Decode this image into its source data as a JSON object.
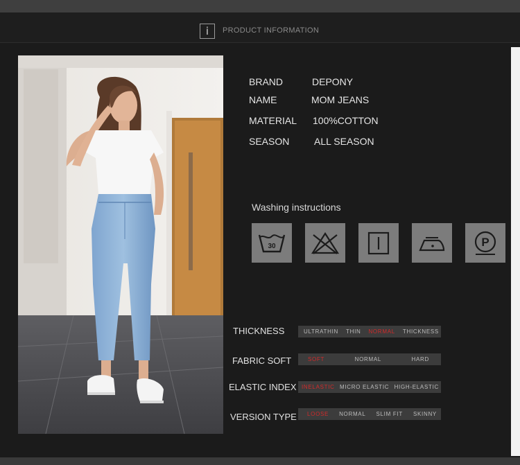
{
  "header": {
    "info_icon_glyph": "i",
    "title": "PRODUCT INFORMATION"
  },
  "product": {
    "photo_icon": "model-photo",
    "specs": [
      {
        "label": "BRAND",
        "value": "DEPONY"
      },
      {
        "label": "NAME",
        "value": "MOM JEANS"
      },
      {
        "label": "MATERIAL",
        "value": "100%COTTON"
      },
      {
        "label": "SEASON",
        "value": "ALL SEASON"
      }
    ]
  },
  "washing": {
    "title": "Washing instructions",
    "icons": [
      {
        "name": "wash-30-icon",
        "text": "30"
      },
      {
        "name": "do-not-bleach-icon"
      },
      {
        "name": "tumble-dry-icon"
      },
      {
        "name": "iron-icon"
      },
      {
        "name": "dry-clean-p-icon",
        "text": "P"
      }
    ]
  },
  "ratings": [
    {
      "label": "THICKNESS",
      "options": [
        "ULTRATHIN",
        "THIN",
        "NORMAL",
        "THICKNESS"
      ],
      "selected": 2
    },
    {
      "label": "FABRIC SOFT",
      "options": [
        "SOFT",
        "NORMAL",
        "HARD"
      ],
      "selected": 0
    },
    {
      "label": "ELASTIC INDEX",
      "options": [
        "INELASTIC",
        "MICRO ELASTIC",
        "HIGH-ELASTIC"
      ],
      "selected": 0
    },
    {
      "label": "VERSION TYPE",
      "options": [
        "LOOSE",
        "NORMAL",
        "SLIM FIT",
        "SKINNY"
      ],
      "selected": 0
    }
  ],
  "colors": {
    "background": "#1b1b1b",
    "selected": "#d22a2a",
    "icon_tile": "#7c7c7c"
  }
}
